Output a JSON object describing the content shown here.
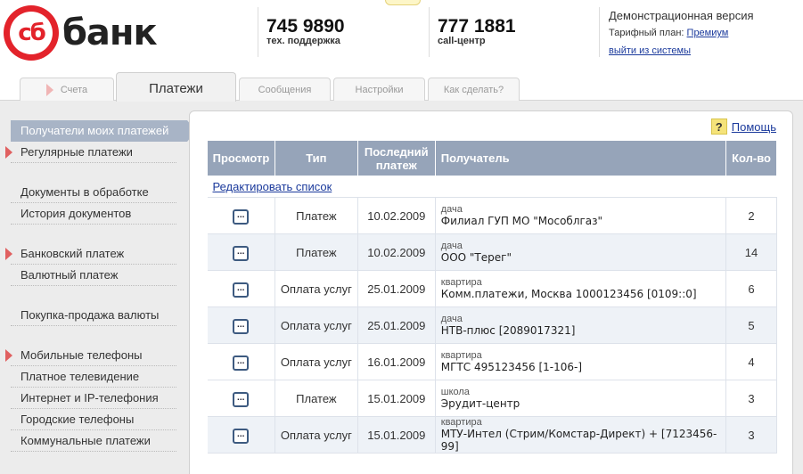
{
  "header": {
    "logo_mark": "сб",
    "logo_word": "банк",
    "phones": [
      {
        "number": "745 9890",
        "label": "тех. поддержка"
      },
      {
        "number": "777 1881",
        "label": "call-центр"
      }
    ],
    "demo_version": "Демонстрационная версия",
    "plan_label": "Тарифный план:",
    "plan_value": "Премиум",
    "logout": "выйти из системы"
  },
  "tabs": [
    {
      "label": "Счета"
    },
    {
      "label": "Платежи"
    },
    {
      "label": "Сообщения"
    },
    {
      "label": "Настройки"
    },
    {
      "label": "Как сделать?"
    }
  ],
  "sidebar": {
    "items": [
      {
        "label": "Получатели моих платежей"
      },
      {
        "label": "Регулярные платежи"
      },
      {
        "label": "Документы в обработке"
      },
      {
        "label": "История документов"
      },
      {
        "label": "Банковский платеж"
      },
      {
        "label": "Валютный платеж"
      },
      {
        "label": "Покупка-продажа валюты"
      },
      {
        "label": "Мобильные телефоны"
      },
      {
        "label": "Платное телевидение"
      },
      {
        "label": "Интернет и IP-телефония"
      },
      {
        "label": "Городские телефоны"
      },
      {
        "label": "Коммунальные платежи"
      }
    ]
  },
  "help": {
    "icon": "?",
    "label": "Помощь"
  },
  "table": {
    "headers": [
      "Просмотр",
      "Тип",
      "Последний платеж",
      "Получатель",
      "Кол-во"
    ],
    "edit_link": "Редактировать список",
    "view_glyph": "...",
    "rows": [
      {
        "type": "Платеж",
        "date": "10.02.2009",
        "category": "дача",
        "name": "Филиал ГУП МО \"Мособлгаз\"",
        "count": "2"
      },
      {
        "type": "Платеж",
        "date": "10.02.2009",
        "category": "дача",
        "name": "ООО \"Терег\"",
        "count": "14"
      },
      {
        "type": "Оплата услуг",
        "date": "25.01.2009",
        "category": "квартира",
        "name": "Комм.платежи, Москва 1000123456 [0109::0]",
        "count": "6"
      },
      {
        "type": "Оплата услуг",
        "date": "25.01.2009",
        "category": "дача",
        "name": "НТВ-плюс [2089017321]",
        "count": "5"
      },
      {
        "type": "Оплата услуг",
        "date": "16.01.2009",
        "category": "квартира",
        "name": "МГТС 495123456 [1-106-]",
        "count": "4"
      },
      {
        "type": "Платеж",
        "date": "15.01.2009",
        "category": "школа",
        "name": "Эрудит-центр",
        "count": "3"
      },
      {
        "type": "Оплата услуг",
        "date": "15.01.2009",
        "category": "квартира",
        "name": "МТУ-Интел (Стрим/Комстар-Директ) + [7123456-99]",
        "count": "3"
      }
    ]
  }
}
